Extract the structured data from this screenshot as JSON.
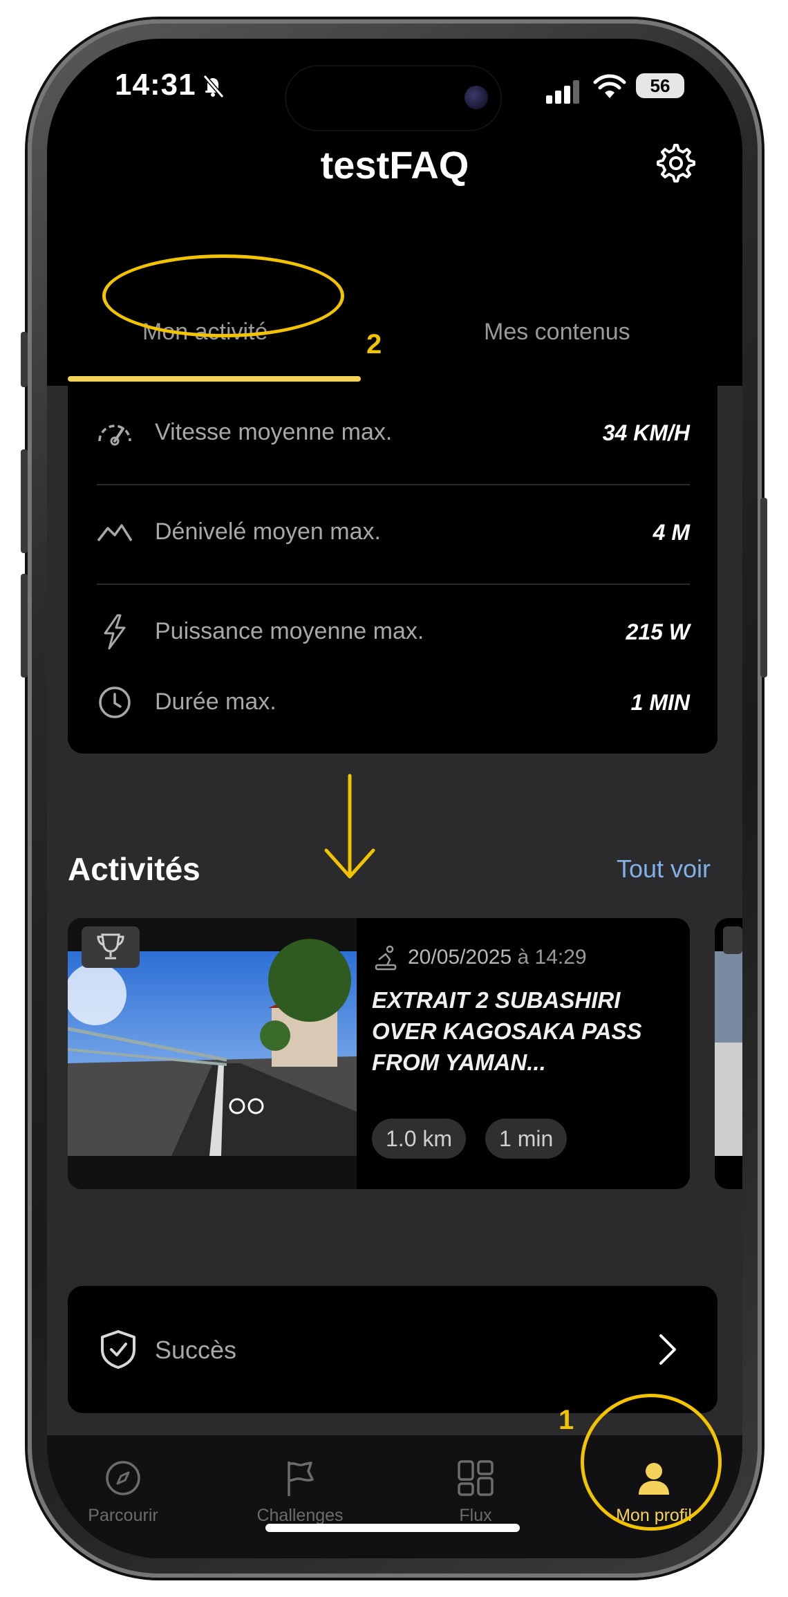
{
  "status_bar": {
    "time": "14:31",
    "battery": "56"
  },
  "header": {
    "title": "testFAQ"
  },
  "tabs": [
    {
      "label": "Mon activité",
      "active": true
    },
    {
      "label": "Mes contenus",
      "active": false
    }
  ],
  "annotations": {
    "tab_number": "2",
    "nav_number": "1"
  },
  "stats": [
    {
      "icon": "speedometer-icon",
      "label": "Vitesse moyenne max.",
      "value": "34 KM/H"
    },
    {
      "icon": "mountain-icon",
      "label": "Dénivelé moyen max.",
      "value": "4 M"
    },
    {
      "icon": "lightning-icon",
      "label": "Puissance moyenne max.",
      "value": "215 W"
    },
    {
      "icon": "clock-icon",
      "label": "Durée max.",
      "value": "1 MIN"
    }
  ],
  "activities": {
    "title": "Activités",
    "see_all": "Tout voir",
    "items": [
      {
        "date": "20/05/2025",
        "at": "à",
        "time": "14:29",
        "title": "EXTRAIT 2 SUBASHIRI OVER KAGOSAKA PASS FROM YAMAN...",
        "distance": "1.0 km",
        "duration": "1 min"
      }
    ]
  },
  "success": {
    "label": "Succès"
  },
  "bottom_nav": [
    {
      "label": "Parcourir",
      "icon": "compass-icon"
    },
    {
      "label": "Challenges",
      "icon": "flag-icon"
    },
    {
      "label": "Flux",
      "icon": "grid-icon"
    },
    {
      "label": "Mon profil",
      "icon": "user-icon",
      "active": true
    }
  ],
  "colors": {
    "accent": "#f5d25a",
    "link": "#82b0e8",
    "annotation": "#f2c400"
  }
}
